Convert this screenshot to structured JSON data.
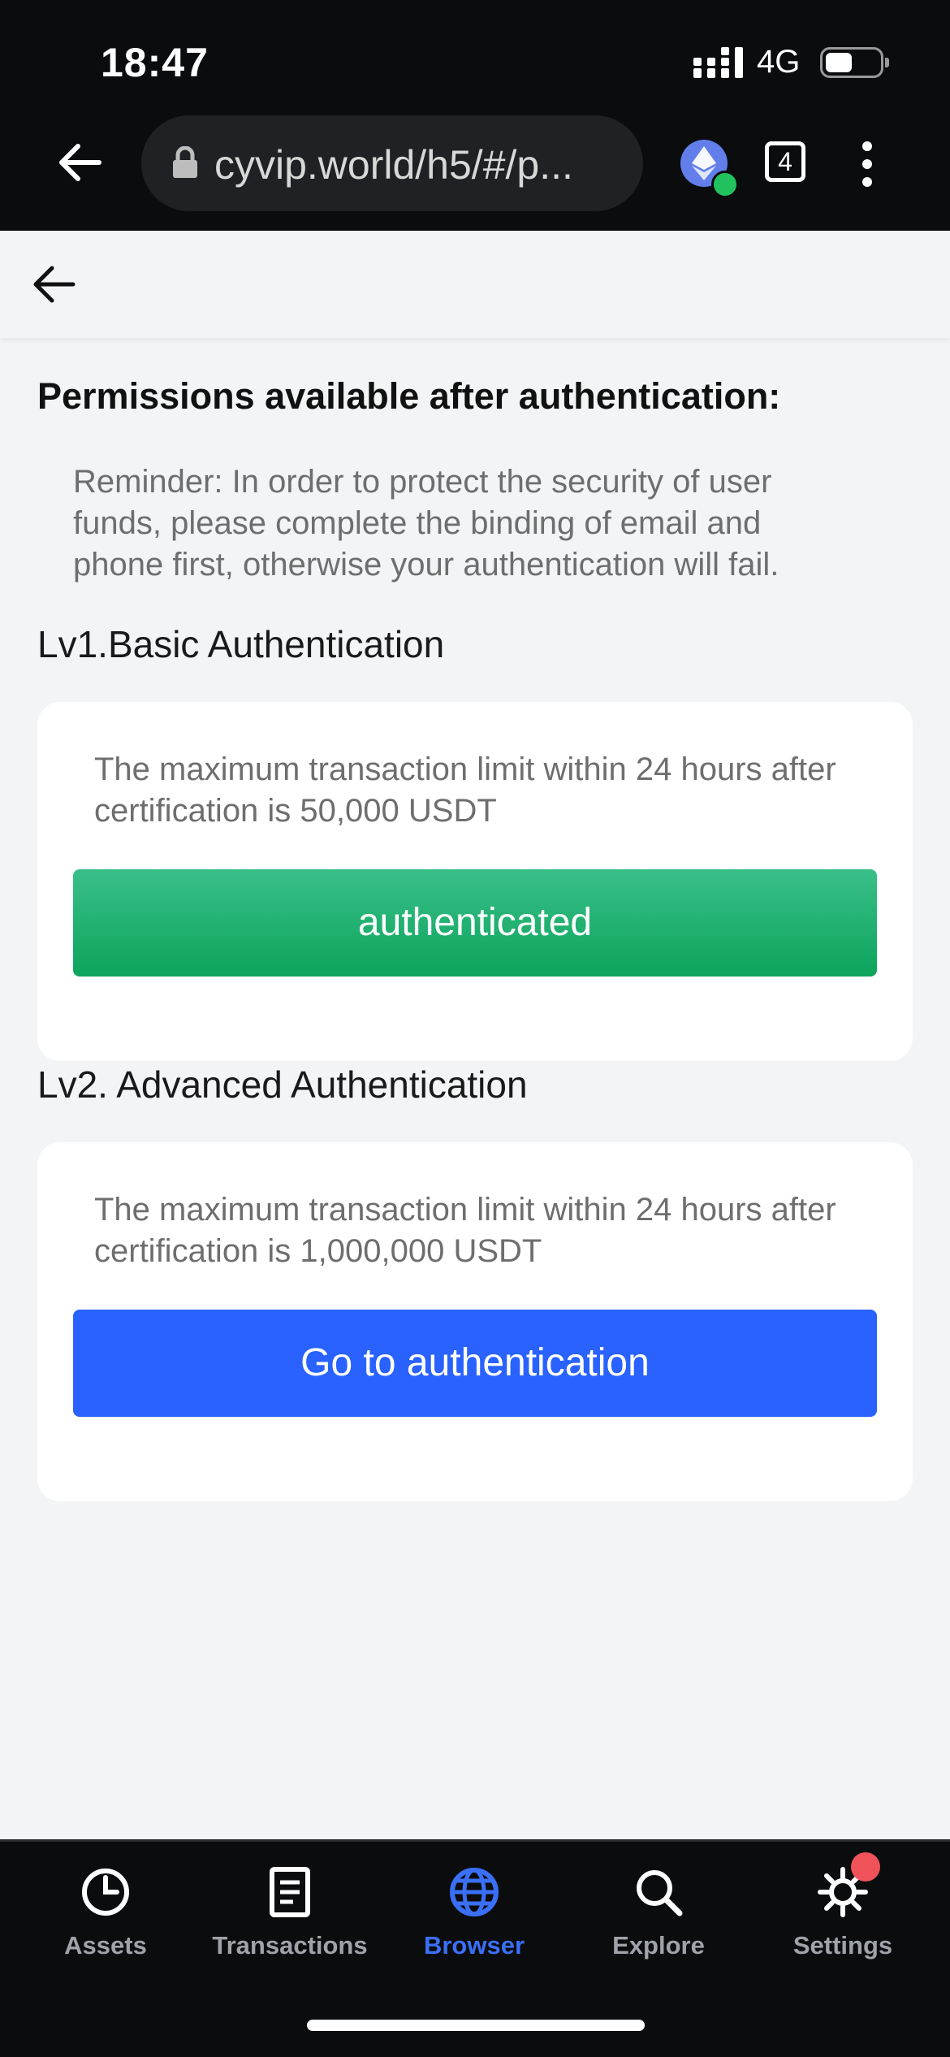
{
  "status_bar": {
    "time": "18:47",
    "network": "4G"
  },
  "browser": {
    "url": "cyvip.world/h5/#/p...",
    "tab_count": "4"
  },
  "page": {
    "title": "Permissions available after authentication:",
    "reminder": "Reminder: In order to protect the security of user funds, please complete the binding of email and phone first, otherwise your authentication will fail.",
    "levels": [
      {
        "label": "Lv1.Basic Authentication",
        "description": "The maximum transaction limit within 24 hours after certification is 50,000 USDT",
        "button": "authenticated"
      },
      {
        "label": "Lv2. Advanced Authentication",
        "description": "The maximum transaction limit within 24 hours after certification is 1,000,000 USDT",
        "button": "Go to authentication"
      }
    ]
  },
  "nav": {
    "items": [
      {
        "label": "Assets",
        "icon": "pie-chart-icon"
      },
      {
        "label": "Transactions",
        "icon": "document-icon"
      },
      {
        "label": "Browser",
        "icon": "globe-icon",
        "active": true
      },
      {
        "label": "Explore",
        "icon": "search-icon"
      },
      {
        "label": "Settings",
        "icon": "gear-icon"
      }
    ]
  },
  "colors": {
    "accent_blue": "#2962ff",
    "success_green": "#0ca45b",
    "nav_active": "#3a6ff7",
    "badge_red": "#f0525a"
  }
}
